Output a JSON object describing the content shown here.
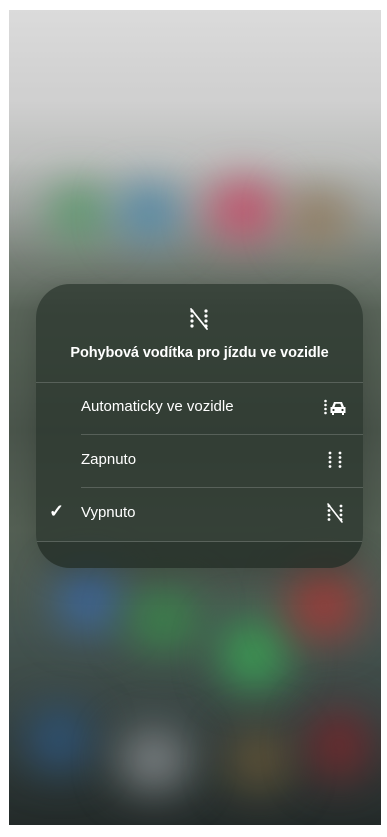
{
  "dialog": {
    "icon": "motion-cues-off-icon",
    "title": "Pohybová vodítka pro jízdu ve vozidle"
  },
  "options": [
    {
      "label": "Automaticky ve vozidle",
      "icon": "motion-cues-car-icon",
      "selected": false
    },
    {
      "label": "Zapnuto",
      "icon": "motion-cues-on-icon",
      "selected": false
    },
    {
      "label": "Vypnuto",
      "icon": "motion-cues-off-icon",
      "selected": true
    }
  ],
  "selected_mark": "✓",
  "colors": {
    "card_background": "#2a342c",
    "text": "#ffffff",
    "home_indicator": "#ffffff"
  }
}
